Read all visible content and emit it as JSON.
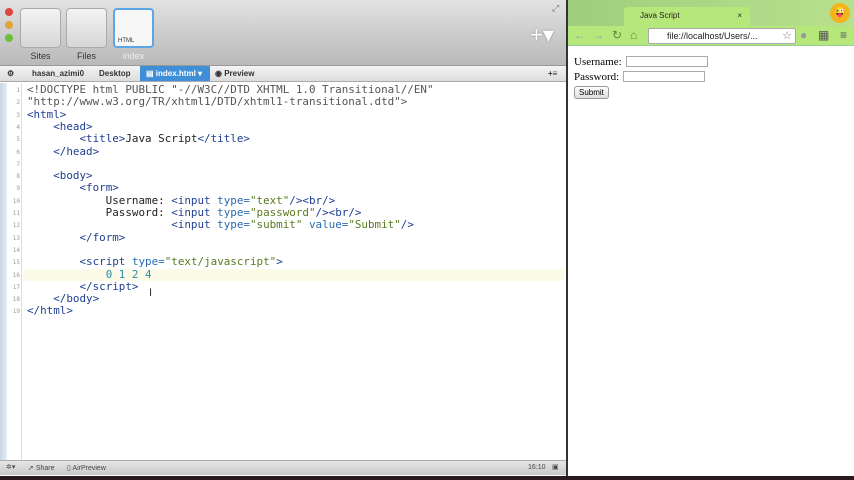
{
  "editor": {
    "toolbar": {
      "tiles": [
        {
          "label": "Sites"
        },
        {
          "label": "Files"
        },
        {
          "label": "index",
          "badge": "HTML"
        }
      ],
      "add_icon": "plus-icon"
    },
    "breadcrumb": {
      "items": [
        "hasan_azimi0",
        "Desktop",
        "index.html"
      ],
      "preview": "Preview"
    },
    "lines": [
      [
        [
          "d",
          "<!DOCTYPE html PUBLIC \"-//W3C//DTD XHTML 1.0 Transitional//EN\""
        ]
      ],
      [
        [
          "d",
          "\"http://www.w3.org/TR/xhtml1/DTD/xhtml1-transitional.dtd\">"
        ]
      ],
      [
        [
          "t",
          "<html>"
        ]
      ],
      [
        [
          "p",
          "    "
        ],
        [
          "t",
          "<head>"
        ]
      ],
      [
        [
          "p",
          "        "
        ],
        [
          "t",
          "<title>"
        ],
        [
          "p",
          "Java Script"
        ],
        [
          "t",
          "</title>"
        ]
      ],
      [
        [
          "p",
          "    "
        ],
        [
          "t",
          "</head>"
        ]
      ],
      [
        [
          "p",
          ""
        ]
      ],
      [
        [
          "p",
          "    "
        ],
        [
          "t",
          "<body>"
        ]
      ],
      [
        [
          "p",
          "        "
        ],
        [
          "t",
          "<form>"
        ]
      ],
      [
        [
          "p",
          "            Username: "
        ],
        [
          "t",
          "<input "
        ],
        [
          "a",
          "type="
        ],
        [
          "s",
          "\"text\""
        ],
        [
          "t",
          "/><br/>"
        ]
      ],
      [
        [
          "p",
          "            Password: "
        ],
        [
          "t",
          "<input "
        ],
        [
          "a",
          "type="
        ],
        [
          "s",
          "\"password\""
        ],
        [
          "t",
          "/><br/>"
        ]
      ],
      [
        [
          "p",
          "                      "
        ],
        [
          "t",
          "<input "
        ],
        [
          "a",
          "type="
        ],
        [
          "s",
          "\"submit\" "
        ],
        [
          "a",
          "value="
        ],
        [
          "s",
          "\"Submit\""
        ],
        [
          "t",
          "/>"
        ]
      ],
      [
        [
          "p",
          "        "
        ],
        [
          "t",
          "</form>"
        ]
      ],
      [
        [
          "p",
          ""
        ]
      ],
      [
        [
          "p",
          "        "
        ],
        [
          "t",
          "<script "
        ],
        [
          "a",
          "type="
        ],
        [
          "s",
          "\"text/javascript\""
        ],
        [
          "t",
          ">"
        ]
      ],
      [
        [
          "p",
          "            "
        ],
        [
          "n",
          "0 1 2 4"
        ]
      ],
      [
        [
          "p",
          "        "
        ],
        [
          "t",
          "</script>"
        ]
      ],
      [
        [
          "p",
          "    "
        ],
        [
          "t",
          "</body>"
        ]
      ],
      [
        [
          "t",
          "</html>"
        ]
      ]
    ],
    "current_line": 16,
    "status": {
      "share": "Share",
      "airpreview": "AirPreview",
      "position": "16:10"
    }
  },
  "browser": {
    "tab_title": "Java Script",
    "address": "file://localhost/Users/...",
    "form": {
      "username_label": "Username:",
      "password_label": "Password:",
      "submit_label": "Submit"
    }
  }
}
